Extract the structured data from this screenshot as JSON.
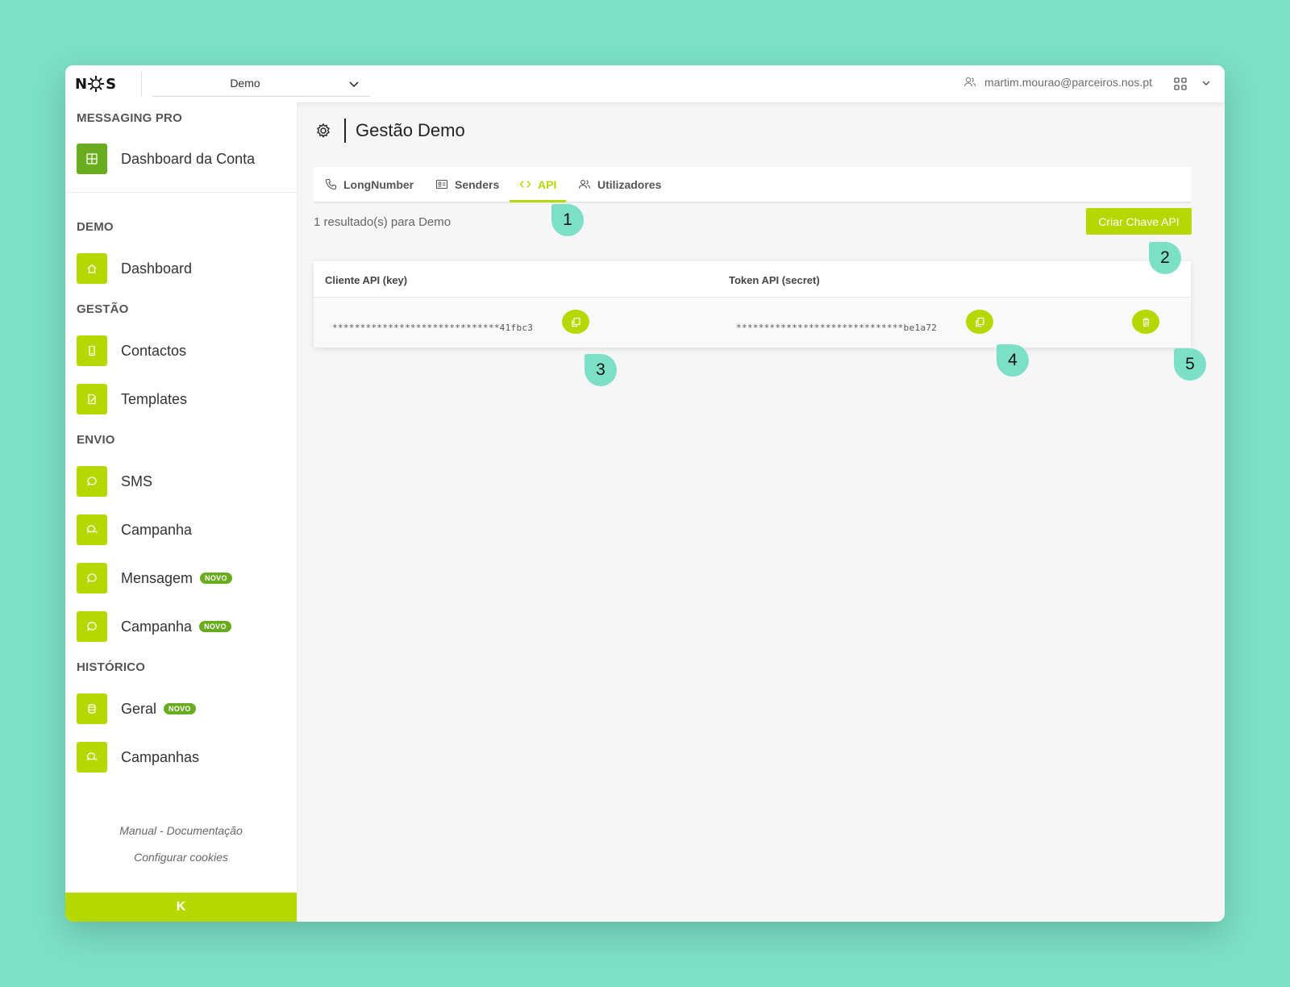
{
  "topbar": {
    "logo": "NOS",
    "org_selected": "Demo",
    "user_email": "martim.mourao@parceiros.nos.pt"
  },
  "sidebar": {
    "product_title": "MESSAGING PRO",
    "account_dashboard": "Dashboard da Conta",
    "sections": {
      "demo": "DEMO",
      "gestao": "GESTÃO",
      "envio": "ENVIO",
      "historico": "HISTÓRICO"
    },
    "items": {
      "dashboard": "Dashboard",
      "contactos": "Contactos",
      "templates": "Templates",
      "sms": "SMS",
      "campanha": "Campanha",
      "mensagem": "Mensagem",
      "campanha_novo": "Campanha",
      "geral": "Geral",
      "campanhas": "Campanhas"
    },
    "badge_new": "NOVO",
    "links": {
      "manual": "Manual - Documentação",
      "cookies": "Configurar cookies"
    },
    "collapse_label": "K"
  },
  "main": {
    "title": "Gestão Demo",
    "tabs": {
      "longnumber": "LongNumber",
      "senders": "Senders",
      "api": "API",
      "utilizadores": "Utilizadores"
    },
    "results_text": "1 resultado(s) para Demo",
    "create_button": "Criar Chave API",
    "table": {
      "col_key": "Cliente API (key)",
      "col_token": "Token API (secret)",
      "rows": [
        {
          "key": "******************************41fbc3",
          "token": "******************************be1a72"
        }
      ]
    }
  },
  "annotations": {
    "m1": "1",
    "m2": "2",
    "m3": "3",
    "m4": "4",
    "m5": "5"
  },
  "colors": {
    "accent": "#b5d900",
    "accent_dark": "#6aac1f",
    "background": "#7ce0c6"
  }
}
